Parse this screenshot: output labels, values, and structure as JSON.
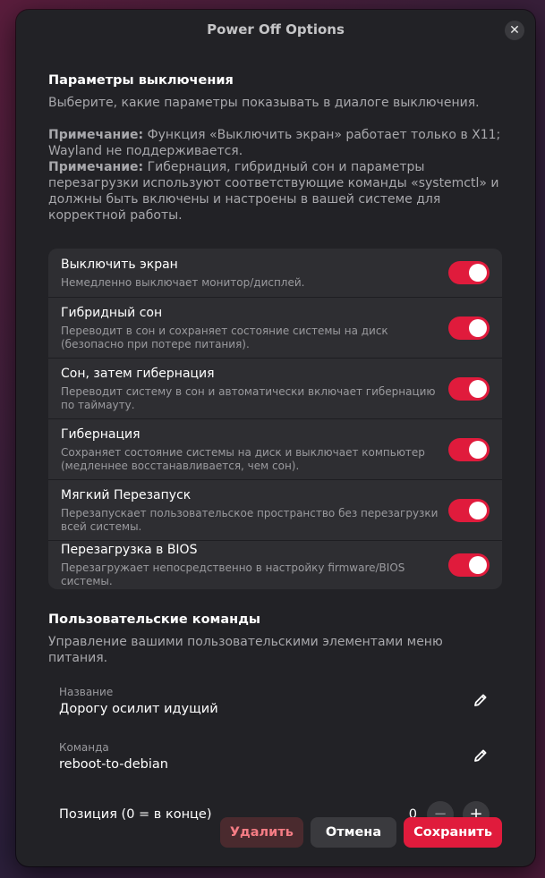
{
  "window": {
    "title": "Power Off Options",
    "close_glyph": "✕"
  },
  "intro": {
    "title": "Параметры выключения",
    "description": "Выберите, какие параметры показывать в диалоге выключения.",
    "note1_label": "Примечание:",
    "note1_text": " Функция «Выключить экран» работает только в X11; Wayland не поддерживается.",
    "note2_label": "Примечание:",
    "note2_text": " Гибернация, гибридный сон и параметры перезагрузки используют соответствующие команды «systemctl» и должны быть включены и настроены в вашей системе для корректной работы."
  },
  "options": [
    {
      "title": "Выключить экран",
      "subtitle": "Немедленно выключает монитор/дисплей.",
      "enabled": true
    },
    {
      "title": "Гибридный сон",
      "subtitle": "Переводит в сон и сохраняет состояние системы на диск (безопасно при потере питания).",
      "enabled": true
    },
    {
      "title": "Сон, затем гибернация",
      "subtitle": "Переводит систему в сон и автоматически включает гибернацию по таймауту.",
      "enabled": true
    },
    {
      "title": "Гибернация",
      "subtitle": "Сохраняет состояние системы на диск и выключает компьютер (медленнее восстанавливается, чем сон).",
      "enabled": true
    },
    {
      "title": "Мягкий Перезапуск",
      "subtitle": "Перезапускает пользовательское пространство без перезагрузки всей системы.",
      "enabled": true
    },
    {
      "title": "Перезагрузка в BIOS",
      "subtitle": "Перезагружает непосредственно в настройку firmware/BIOS системы.",
      "enabled": true
    }
  ],
  "custom": {
    "title": "Пользовательские команды",
    "description": "Управление вашими пользовательскими элементами меню питания.",
    "name_label": "Название",
    "name_value": "Дорогу осилит идущий",
    "command_label": "Команда",
    "command_value": "reboot-to-debian",
    "position_label": "Позиция (0 = в конце)",
    "position_value": "0",
    "minus_glyph": "−",
    "plus_glyph": "+"
  },
  "buttons": {
    "delete": "Удалить",
    "cancel": "Отмена",
    "save": "Сохранить"
  },
  "colors": {
    "accent": "#e01b3c",
    "dialog_bg": "#222226",
    "list_bg": "#2e2e32",
    "delete_text": "#f47c84"
  },
  "icons": {
    "edit": "pencil-icon",
    "close": "close-icon"
  }
}
